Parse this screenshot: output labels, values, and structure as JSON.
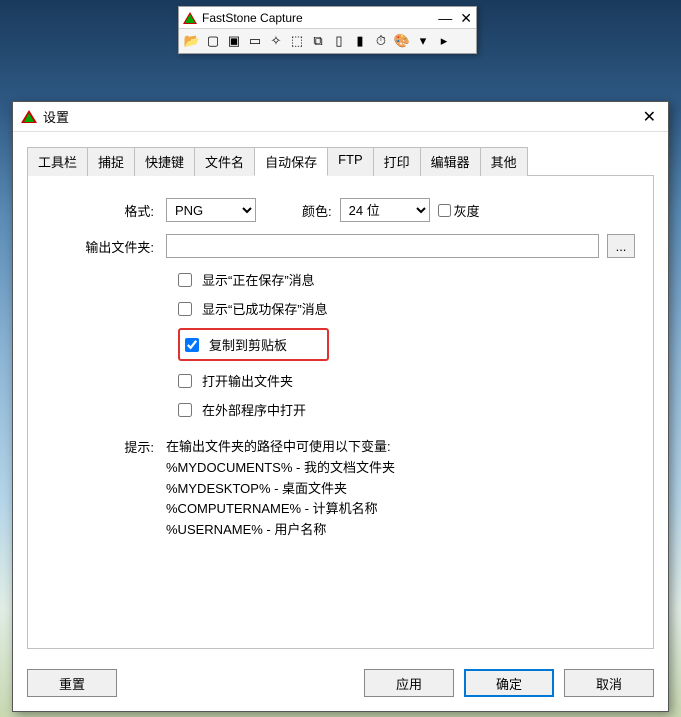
{
  "fs_window": {
    "title": "FastStone Capture",
    "tools": [
      "open",
      "window",
      "fullscreen",
      "rect",
      "freehand",
      "region",
      "scroll",
      "fixed",
      "record",
      "timer",
      "palette",
      "more",
      "settings"
    ]
  },
  "dialog": {
    "title": "设置",
    "tabs": [
      "工具栏",
      "捕捉",
      "快捷键",
      "文件名",
      "自动保存",
      "FTP",
      "打印",
      "编辑器",
      "其他"
    ],
    "active_tab": 4,
    "format_label": "格式:",
    "format_value": "PNG",
    "color_label": "颜色:",
    "color_value": "24 位",
    "grayscale_label": "灰度",
    "grayscale_checked": false,
    "output_label": "输出文件夹:",
    "output_value": "",
    "browse_text": "...",
    "checks": [
      {
        "label": "显示“正在保存”消息",
        "checked": false
      },
      {
        "label": "显示“已成功保存”消息",
        "checked": false
      },
      {
        "label": "复制到剪贴板",
        "checked": true,
        "highlight": true
      },
      {
        "label": "打开输出文件夹",
        "checked": false
      },
      {
        "label": "在外部程序中打开",
        "checked": false
      }
    ],
    "hint_label": "提示:",
    "hint_intro": "在输出文件夹的路径中可使用以下变量:",
    "hint_lines": [
      "%MYDOCUMENTS% - 我的文档文件夹",
      "%MYDESKTOP% - 桌面文件夹",
      "%COMPUTERNAME% - 计算机名称",
      "%USERNAME% - 用户名称"
    ],
    "btn_reset": "重置",
    "btn_apply": "应用",
    "btn_ok": "确定",
    "btn_cancel": "取消"
  }
}
